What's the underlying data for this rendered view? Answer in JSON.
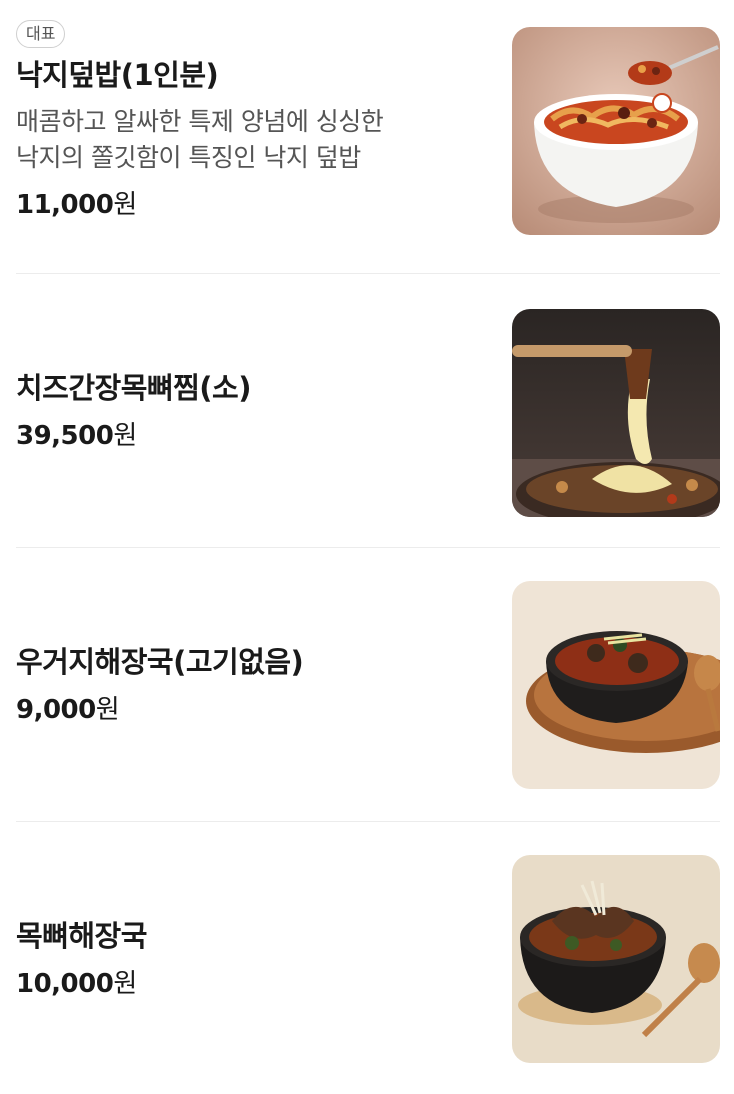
{
  "menu": {
    "items": [
      {
        "badge": "대표",
        "name": "낙지덮밥(1인분)",
        "description_line1": "매콤하고 알싸한 특제 양념에 싱싱한",
        "description_line2": "낙지의 쫄깃함이 특징인 낙지 덮밥",
        "price": "11,000",
        "currency": "원",
        "image": "nakji-deopbap-photo"
      },
      {
        "name": "치즈간장목뼈찜(소)",
        "price": "39,500",
        "currency": "원",
        "image": "cheese-soy-braised-pork-neck-photo"
      },
      {
        "name": "우거지해장국(고기없음)",
        "price": "9,000",
        "currency": "원",
        "image": "ugeoji-haejangguk-photo"
      },
      {
        "name": "목뼈해장국",
        "price": "10,000",
        "currency": "원",
        "image": "pork-neck-haejangguk-photo"
      }
    ]
  }
}
